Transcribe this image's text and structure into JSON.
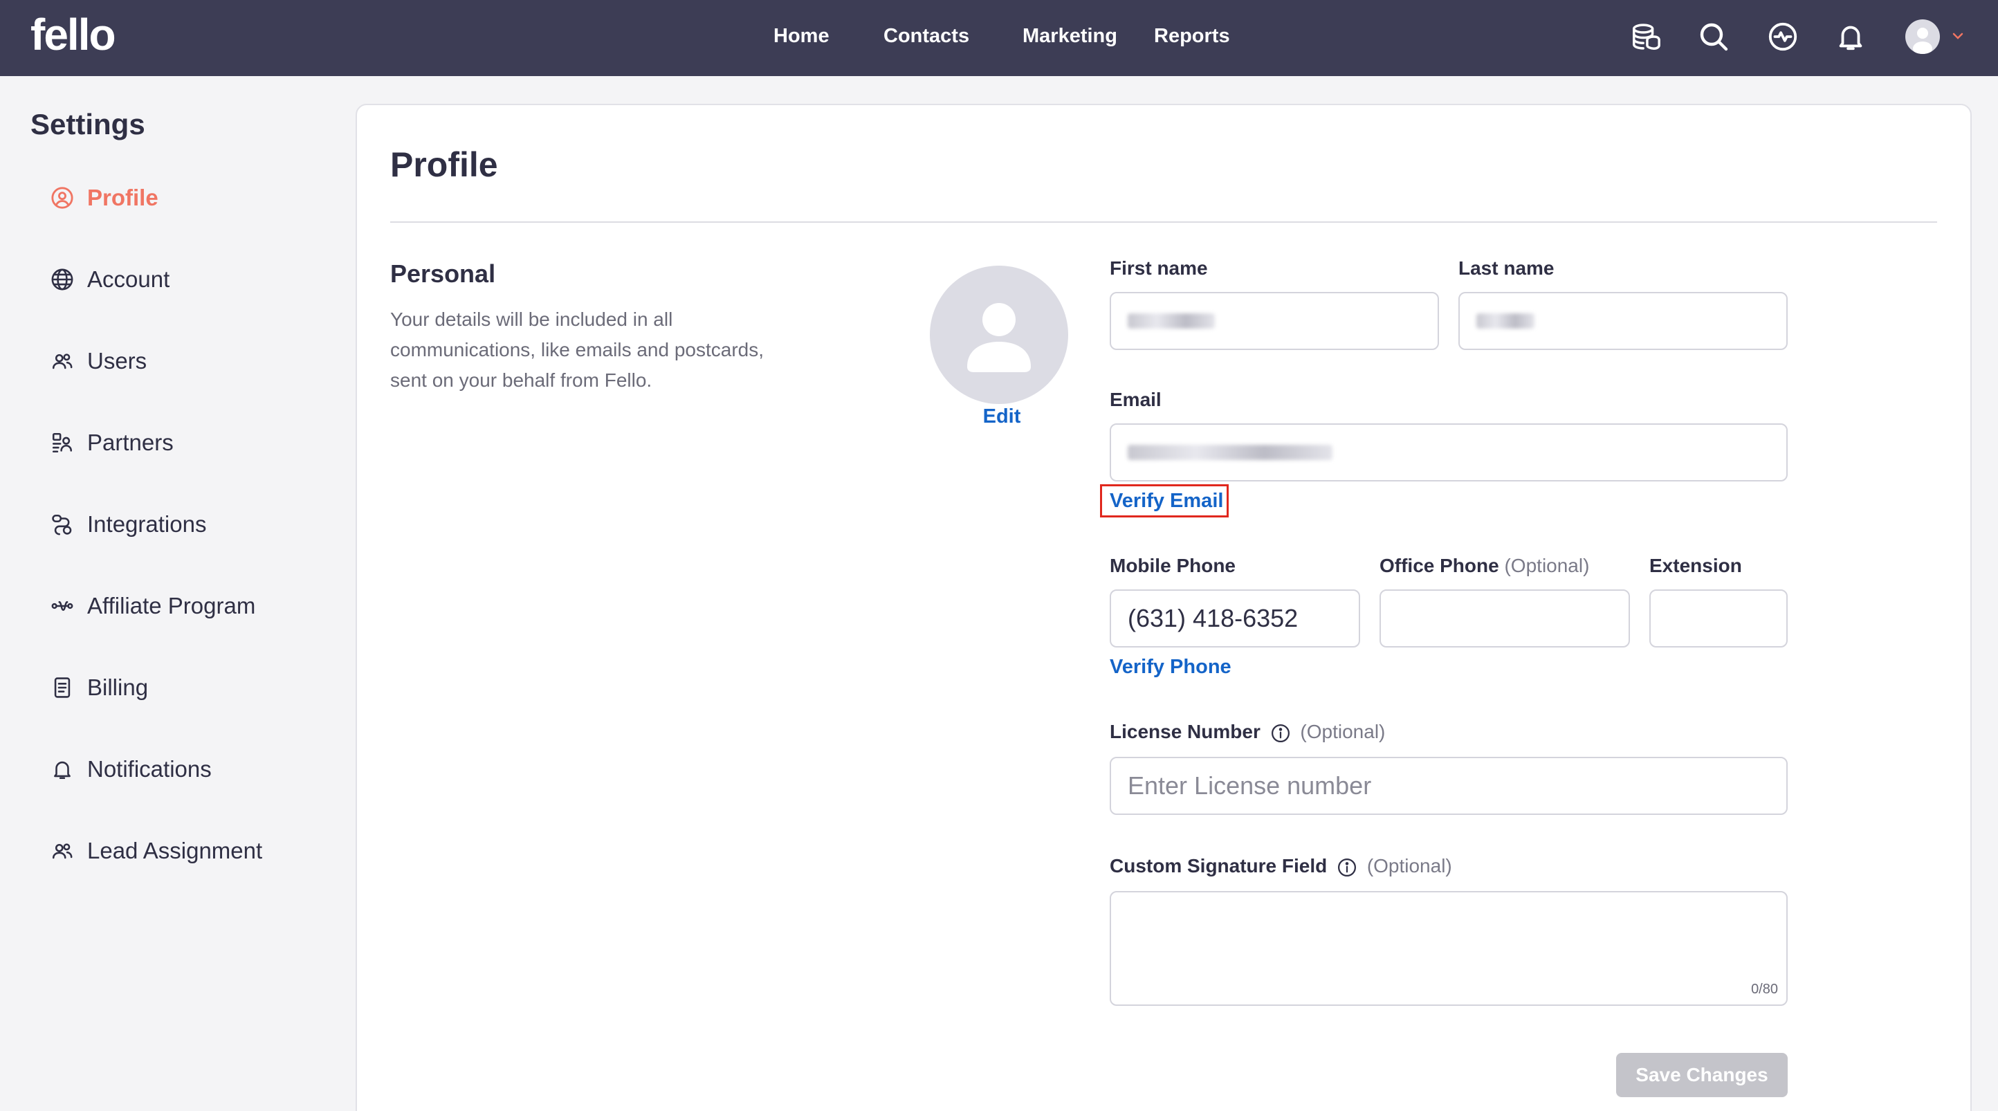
{
  "app": {
    "logo": "fello"
  },
  "nav": {
    "links": [
      "Home",
      "Contacts",
      "Marketing",
      "Reports"
    ],
    "icons": [
      "coins-icon",
      "search-icon",
      "activity-icon",
      "bell-icon",
      "user-avatar",
      "chevron-down-icon"
    ]
  },
  "sidebar": {
    "title": "Settings",
    "items": [
      {
        "label": "Profile",
        "icon": "user-circle-icon",
        "active": true
      },
      {
        "label": "Account",
        "icon": "globe-icon"
      },
      {
        "label": "Users",
        "icon": "users-icon"
      },
      {
        "label": "Partners",
        "icon": "partners-icon"
      },
      {
        "label": "Integrations",
        "icon": "integrations-icon"
      },
      {
        "label": "Affiliate Program",
        "icon": "affiliate-icon"
      },
      {
        "label": "Billing",
        "icon": "document-icon"
      },
      {
        "label": "Notifications",
        "icon": "bell-icon"
      },
      {
        "label": "Lead Assignment",
        "icon": "users-icon"
      }
    ]
  },
  "main": {
    "title": "Profile",
    "section": {
      "title": "Personal",
      "description": "Your details will be included in all communications, like emails and postcards, sent on your behalf from Fello."
    },
    "avatar": {
      "edit_label": "Edit"
    },
    "fields": {
      "first_name": {
        "label": "First name"
      },
      "last_name": {
        "label": "Last name"
      },
      "email": {
        "label": "Email",
        "verify_label": "Verify Email"
      },
      "mobile_phone": {
        "label": "Mobile Phone",
        "value": "(631) 418-6352",
        "verify_label": "Verify Phone"
      },
      "office_phone": {
        "label": "Office Phone",
        "optional": "(Optional)"
      },
      "extension": {
        "label": "Extension"
      },
      "license_number": {
        "label": "License Number",
        "optional": "(Optional)",
        "placeholder": "Enter License number"
      },
      "custom_signature": {
        "label": "Custom Signature Field",
        "optional": "(Optional)",
        "counter": "0/80"
      }
    },
    "save_label": "Save Changes"
  },
  "colors": {
    "nav_bg": "#3d3d55",
    "active": "#f07563",
    "link": "#1464c8",
    "highlight_box": "#e0281e",
    "disabled_button": "#c4c4ca"
  }
}
